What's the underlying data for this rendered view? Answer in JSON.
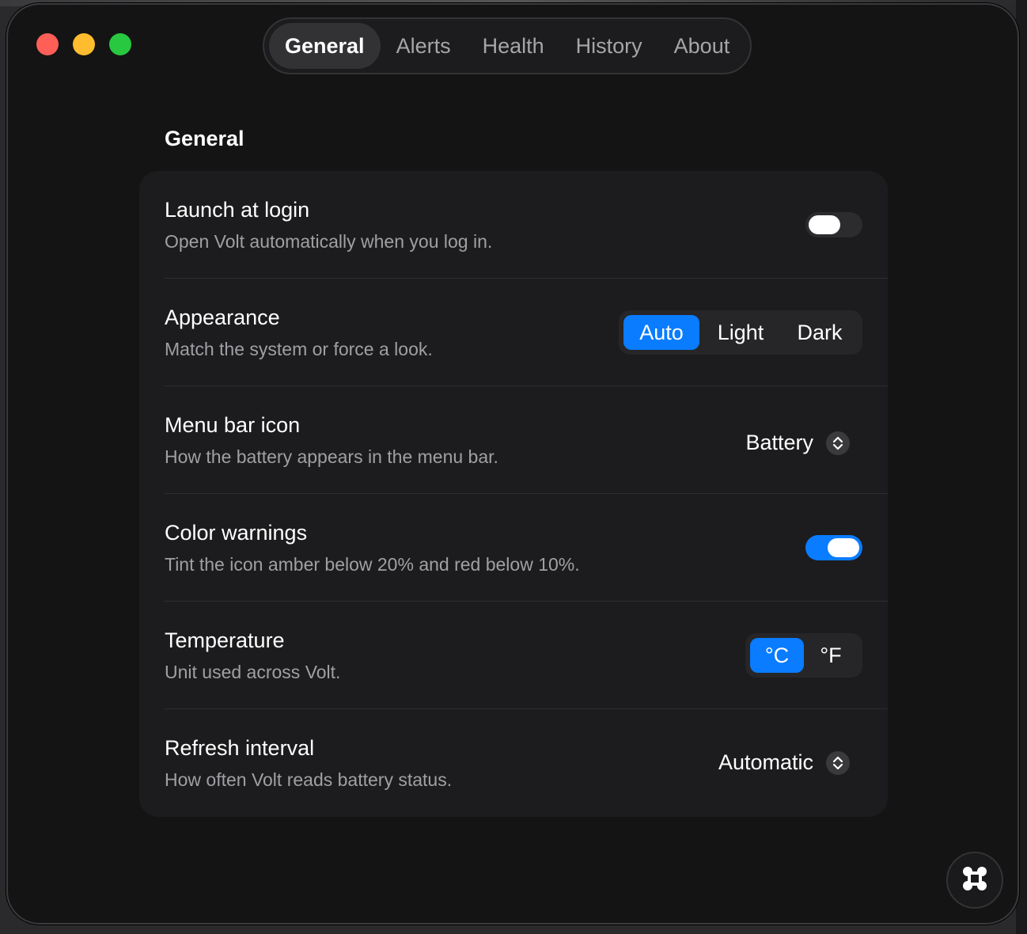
{
  "window": {
    "traffic_lights": [
      "close",
      "minimize",
      "zoom"
    ]
  },
  "tabs": [
    {
      "label": "General",
      "active": true
    },
    {
      "label": "Alerts",
      "active": false
    },
    {
      "label": "Health",
      "active": false
    },
    {
      "label": "History",
      "active": false
    },
    {
      "label": "About",
      "active": false
    }
  ],
  "section": {
    "title": "General"
  },
  "settings": {
    "launch": {
      "title": "Launch at login",
      "desc": "Open Volt automatically when you log in.",
      "enabled": false
    },
    "appearance": {
      "title": "Appearance",
      "desc": "Match the system or force a look.",
      "options": [
        "Auto",
        "Light",
        "Dark"
      ],
      "selected": "Auto"
    },
    "menubar": {
      "title": "Menu bar icon",
      "desc": "How the battery appears in the menu bar.",
      "value": "Battery"
    },
    "warnings": {
      "title": "Color warnings",
      "desc": "Tint the icon amber below 20% and red below 10%.",
      "enabled": true
    },
    "temperature": {
      "title": "Temperature",
      "desc": "Unit used across Volt.",
      "options": [
        "°C",
        "°F"
      ],
      "selected": "°C"
    },
    "refresh": {
      "title": "Refresh interval",
      "desc": "How often Volt reads battery status.",
      "value": "Automatic"
    }
  },
  "colors": {
    "accent": "#0a7cff",
    "window_bg": "#141414",
    "card_bg": "#1c1c1e"
  },
  "icons": {
    "popup": "chevron-up-down-icon",
    "corner": "command-icon"
  }
}
